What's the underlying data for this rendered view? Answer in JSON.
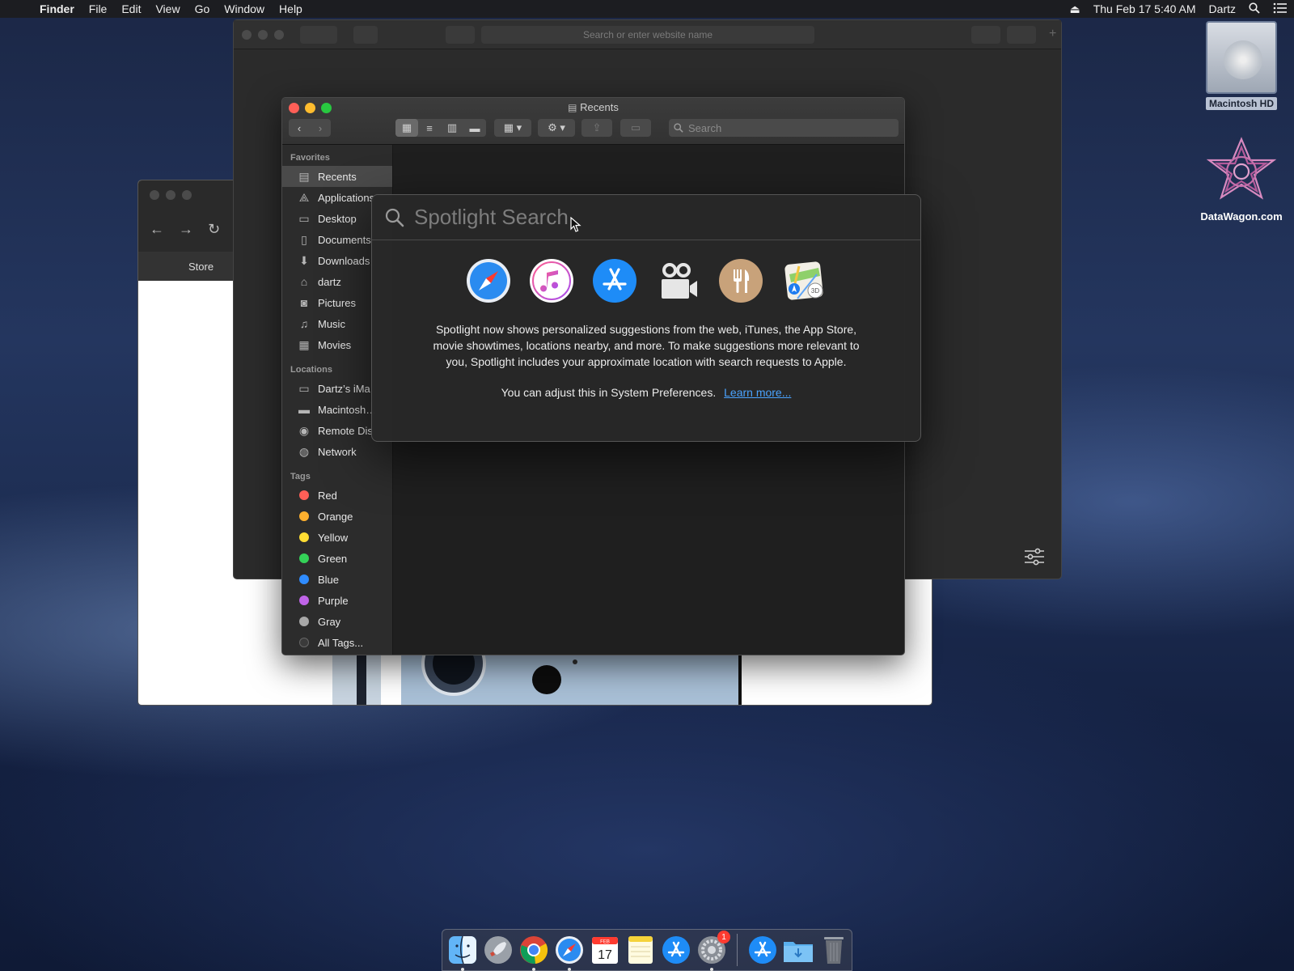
{
  "menubar": {
    "app": "Finder",
    "items": [
      "File",
      "Edit",
      "View",
      "Go",
      "Window",
      "Help"
    ],
    "datetime": "Thu Feb 17  5:40 AM",
    "user": "Dartz"
  },
  "desktop": {
    "hd_label": "Macintosh HD",
    "datawagon_label": "DataWagon.com"
  },
  "safari": {
    "address_placeholder": "Search or enter website name"
  },
  "browser_back": {
    "store_label": "Store"
  },
  "finder": {
    "title": "Recents",
    "search_placeholder": "Search",
    "favorites_header": "Favorites",
    "favorites": [
      {
        "label": "Recents",
        "icon": "recents-icon",
        "glyph": "▤"
      },
      {
        "label": "Applications",
        "icon": "applications-icon",
        "glyph": "⟁"
      },
      {
        "label": "Desktop",
        "icon": "desktop-icon",
        "glyph": "▭"
      },
      {
        "label": "Documents",
        "icon": "documents-icon",
        "glyph": "▯"
      },
      {
        "label": "Downloads",
        "icon": "downloads-icon",
        "glyph": "⬇"
      },
      {
        "label": "dartz",
        "icon": "home-icon",
        "glyph": "⌂"
      },
      {
        "label": "Pictures",
        "icon": "pictures-icon",
        "glyph": "◙"
      },
      {
        "label": "Music",
        "icon": "music-icon",
        "glyph": "♫"
      },
      {
        "label": "Movies",
        "icon": "movies-icon",
        "glyph": "▦"
      }
    ],
    "locations_header": "Locations",
    "locations": [
      {
        "label": "Dartz’s iMa",
        "icon": "computer-icon",
        "glyph": "▭"
      },
      {
        "label": "Macintosh…",
        "icon": "disk-icon",
        "glyph": "▬"
      },
      {
        "label": "Remote Dis",
        "icon": "remote-disc-icon",
        "glyph": "◉"
      },
      {
        "label": "Network",
        "icon": "network-icon",
        "glyph": "◍"
      }
    ],
    "tags_header": "Tags",
    "tags": [
      {
        "label": "Red",
        "color": "#ff5f57"
      },
      {
        "label": "Orange",
        "color": "#ffb02e"
      },
      {
        "label": "Yellow",
        "color": "#ffdd33"
      },
      {
        "label": "Green",
        "color": "#34d158"
      },
      {
        "label": "Blue",
        "color": "#2f8cff"
      },
      {
        "label": "Purple",
        "color": "#c064e8"
      },
      {
        "label": "Gray",
        "color": "#a8a8a8"
      },
      {
        "label": "All Tags...",
        "color": "#3a3a3a"
      }
    ]
  },
  "spotlight": {
    "placeholder": "Spotlight Search",
    "message": "Spotlight now shows personalized suggestions from the web, iTunes, the App Store, movie showtimes, locations nearby, and more. To make suggestions more relevant to you, Spotlight includes your approximate location with search requests to Apple.",
    "footer_text": "You can adjust this in System Preferences.",
    "learn_more": "Learn more...",
    "icons": [
      "safari-icon",
      "itunes-icon",
      "app-store-icon",
      "movies-showtimes-icon",
      "restaurants-icon",
      "maps-icon"
    ]
  },
  "dock": {
    "calendar_month": "FEB",
    "calendar_day": "17",
    "sysprefs_badge": "1"
  },
  "colors": {
    "accent_link": "#4aa3ff",
    "close": "#ff5f57",
    "minimize": "#febc2e",
    "zoom": "#28c840"
  }
}
